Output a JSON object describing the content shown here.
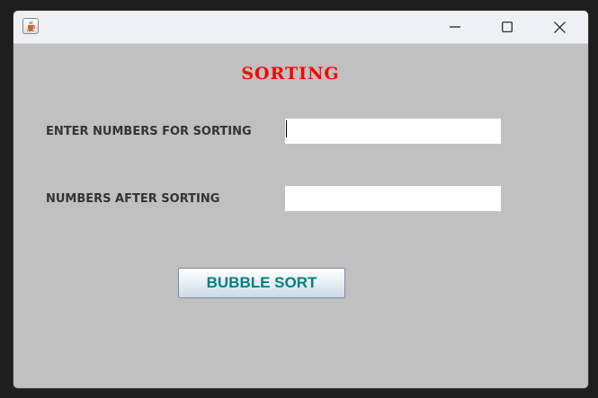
{
  "window": {
    "title": "",
    "icon": "java-cup-icon",
    "controls": {
      "minimize_icon": "minimize-icon",
      "maximize_icon": "maximize-icon",
      "close_icon": "close-icon"
    }
  },
  "form": {
    "heading": "SORTING",
    "input_label": "ENTER NUMBERS FOR SORTING",
    "input_value": "",
    "output_label": "NUMBERS AFTER SORTING",
    "output_value": "",
    "sort_button_label": "BUBBLE SORT"
  },
  "colors": {
    "heading": "#ff0000",
    "panel_background": "#c0c0c0",
    "button_text": "#008080",
    "label_text": "#333333"
  }
}
